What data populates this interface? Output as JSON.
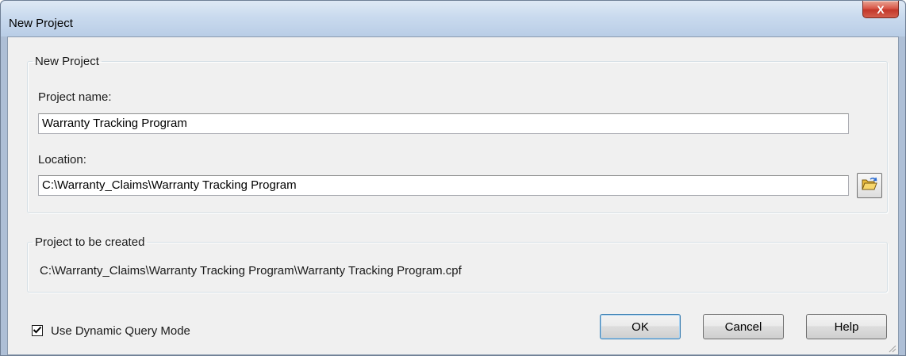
{
  "window": {
    "title": "New Project",
    "close_label": "X"
  },
  "new_project_group": {
    "legend": "New Project",
    "project_name_label": "Project name:",
    "project_name_value": "Warranty Tracking Program",
    "location_label": "Location:",
    "location_value": "C:\\Warranty_Claims\\Warranty Tracking Program",
    "browse_icon": "folder-open-icon"
  },
  "created_group": {
    "legend": "Project to be created",
    "path": "C:\\Warranty_Claims\\Warranty Tracking Program\\Warranty Tracking Program.cpf"
  },
  "options": {
    "dynamic_query_label": "Use Dynamic Query Mode",
    "dynamic_query_checked": true
  },
  "buttons": {
    "ok": "OK",
    "cancel": "Cancel",
    "help": "Help"
  },
  "colors": {
    "title_bar": "#c9daee",
    "close_button": "#c2372a",
    "dialog_face": "#f0f0f0",
    "folder_icon": "#f2c94c"
  }
}
